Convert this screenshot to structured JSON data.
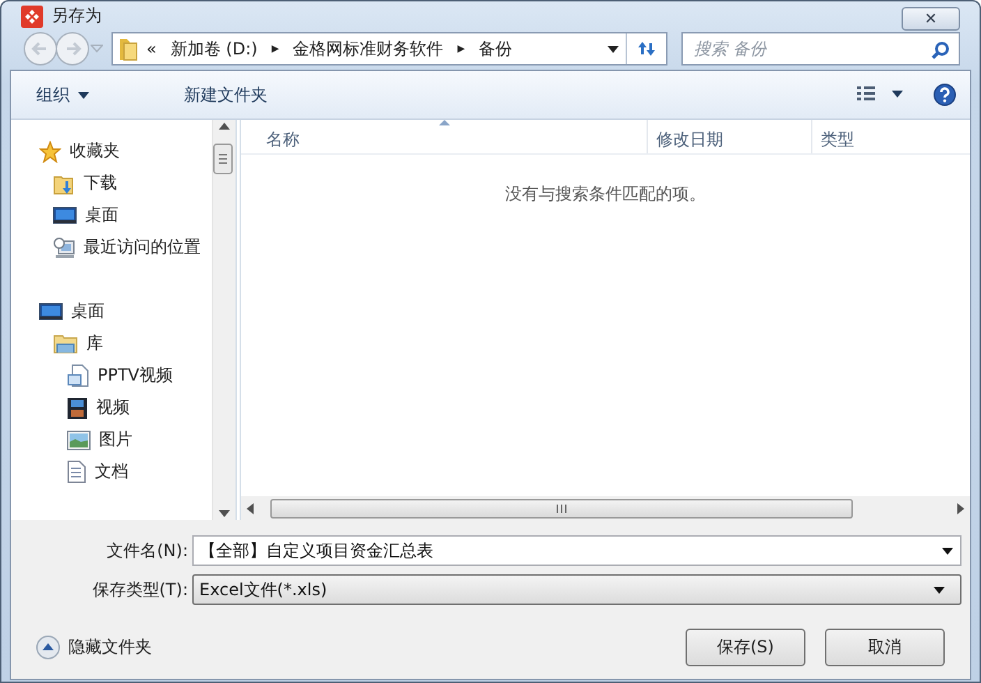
{
  "window": {
    "title": "另存为",
    "close": "✕"
  },
  "address": {
    "overflow": "«",
    "crumbs": [
      "新加卷 (D:)",
      "金格网标准财务软件",
      "备份"
    ],
    "separator": "▶",
    "search_placeholder": "搜索 备份"
  },
  "toolbar": {
    "organize": "组织",
    "new_folder": "新建文件夹"
  },
  "nav": [
    {
      "label": "收藏夹",
      "kind": "star",
      "children": [
        {
          "label": "下载",
          "kind": "download"
        },
        {
          "label": "桌面",
          "kind": "desktop"
        },
        {
          "label": "最近访问的位置",
          "kind": "recent"
        }
      ]
    },
    {
      "label": "桌面",
      "kind": "desktop",
      "children": [
        {
          "label": "库",
          "kind": "library",
          "children": [
            {
              "label": "PPTV视频",
              "kind": "doc"
            },
            {
              "label": "视频",
              "kind": "film"
            },
            {
              "label": "图片",
              "kind": "image"
            },
            {
              "label": "文档",
              "kind": "text"
            }
          ]
        }
      ]
    }
  ],
  "columns": [
    {
      "label": "名称",
      "sorted": true
    },
    {
      "label": "修改日期",
      "sorted": false
    },
    {
      "label": "类型",
      "sorted": false
    }
  ],
  "empty_message": "没有与搜索条件匹配的项。",
  "form": [
    {
      "label": "文件名(N):",
      "value": "【全部】自定义项目资金汇总表",
      "kind": "combo"
    },
    {
      "label": "保存类型(T):",
      "value": "Excel文件(*.xls)",
      "kind": "select"
    }
  ],
  "hide_folders": "隐藏文件夹",
  "buttons": [
    "保存(S)",
    "取消"
  ]
}
